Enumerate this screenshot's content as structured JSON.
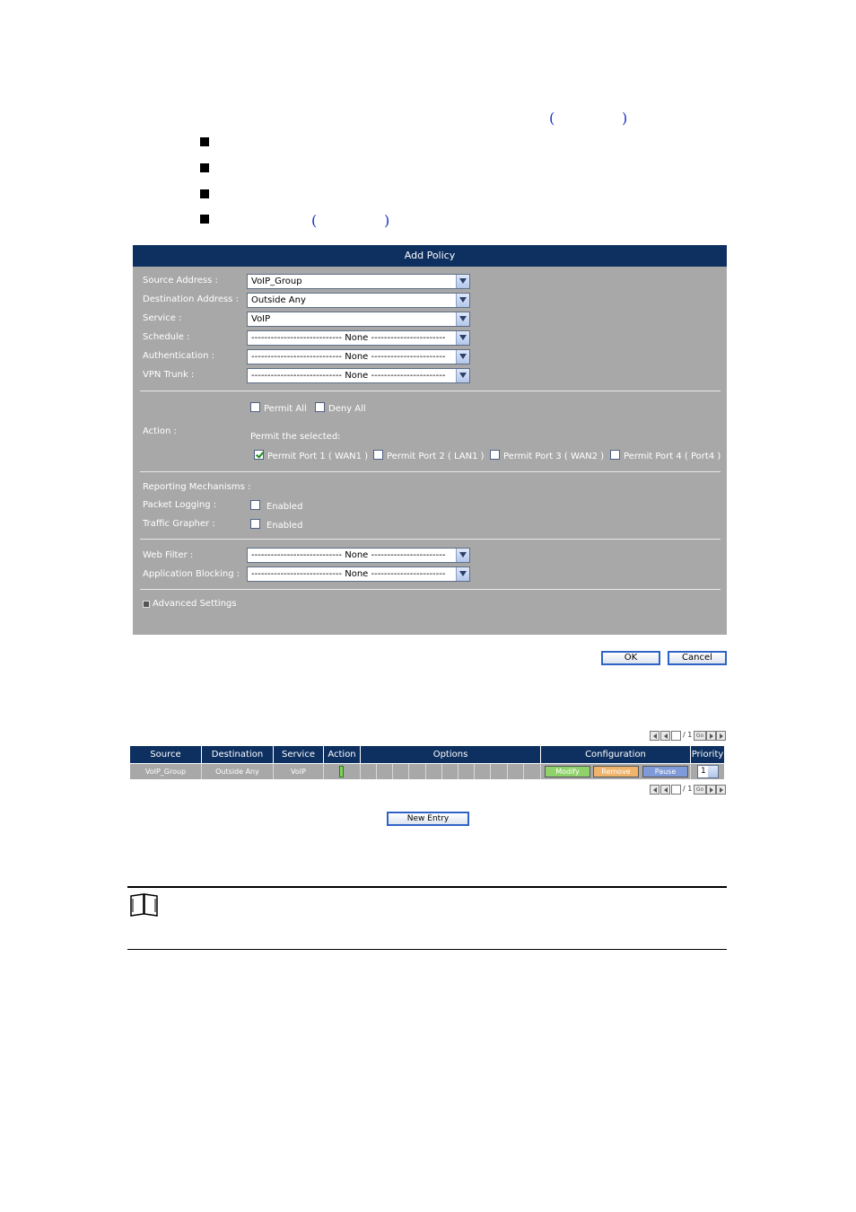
{
  "doc": {
    "paren_open": "(",
    "paren_close": ")"
  },
  "panel": {
    "title": "Add Policy",
    "fields": [
      {
        "label": "Source Address :",
        "value": "VoIP_Group"
      },
      {
        "label": "Destination Address :",
        "value": "Outside Any"
      },
      {
        "label": "Service :",
        "value": "VoIP"
      },
      {
        "label": "Schedule :",
        "value": "---------------------------- None -----------------------"
      },
      {
        "label": "Authentication :",
        "value": "---------------------------- None -----------------------"
      },
      {
        "label": "VPN Trunk :",
        "value": "---------------------------- None -----------------------"
      }
    ],
    "action_label": "Action :",
    "permit_all": "Permit All",
    "deny_all": "Deny All",
    "permit_selected": "Permit the selected:",
    "ports": [
      {
        "label": "Permit Port  1 ( WAN1 )",
        "checked": true
      },
      {
        "label": "Permit Port  2 ( LAN1 )",
        "checked": false
      },
      {
        "label": "Permit Port  3 ( WAN2 )",
        "checked": false
      },
      {
        "label": "Permit Port  4 ( Port4 )",
        "checked": false
      }
    ],
    "reporting": "Reporting Mechanisms :",
    "packet_logging": "Packet Logging :",
    "traffic_grapher": "Traffic Grapher :",
    "enabled": "Enabled",
    "web_filter": "Web Filter :",
    "web_filter_value": "---------------------------- None -----------------------",
    "app_blocking": "Application Blocking :",
    "app_blocking_value": "---------------------------- None -----------------------",
    "advanced": "Advanced Settings"
  },
  "buttons": {
    "ok": "OK",
    "cancel": "Cancel",
    "new_entry": "New Entry"
  },
  "pager": {
    "page_sep": "/ 1",
    "go": "Go"
  },
  "table": {
    "headers": [
      "Source",
      "Destination",
      "Service",
      "Action",
      "Options",
      "Configuration",
      "Priority"
    ],
    "row": {
      "source": "VoIP_Group",
      "destination": "Outside Any",
      "service": "VoIP",
      "modify": "Modify",
      "remove": "Remove",
      "pause": "Pause",
      "priority": "1"
    }
  },
  "colors": {
    "header": "#0e3060",
    "panel": "#a8a8a8",
    "link": "#1a33c8",
    "modify": "#8fd26a",
    "remove": "#f0b36a",
    "pause": "#7f9ad8"
  }
}
